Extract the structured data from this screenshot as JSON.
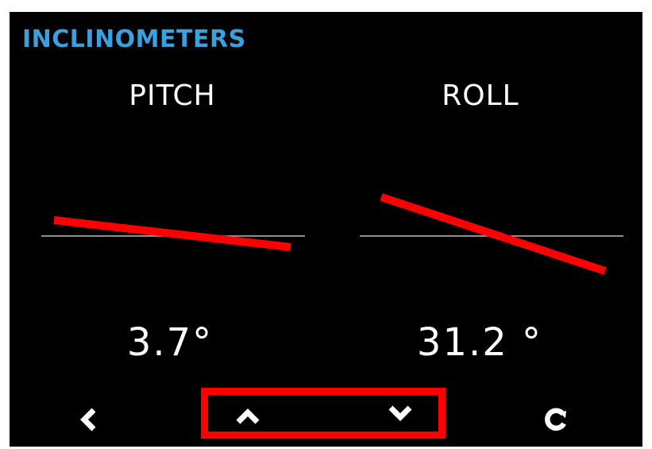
{
  "header": {
    "title": "INCLINOMETERS"
  },
  "gauges": {
    "pitch": {
      "label": "PITCH",
      "value": "3.7°",
      "angle_deg": 3.7
    },
    "roll": {
      "label": "ROLL",
      "value": "31.2 °",
      "angle_deg": 31.2
    }
  },
  "colors": {
    "background": "#000000",
    "title": "#3aa0de",
    "indicator": "#ff0000",
    "reference_line": "#bbbbbb",
    "text": "#ffffff",
    "highlight_box": "#ff0000"
  },
  "nav": {
    "back_icon": "chevron-left-icon",
    "up_icon": "chevron-up-icon",
    "down_icon": "chevron-down-icon",
    "refresh_icon": "refresh-icon"
  }
}
